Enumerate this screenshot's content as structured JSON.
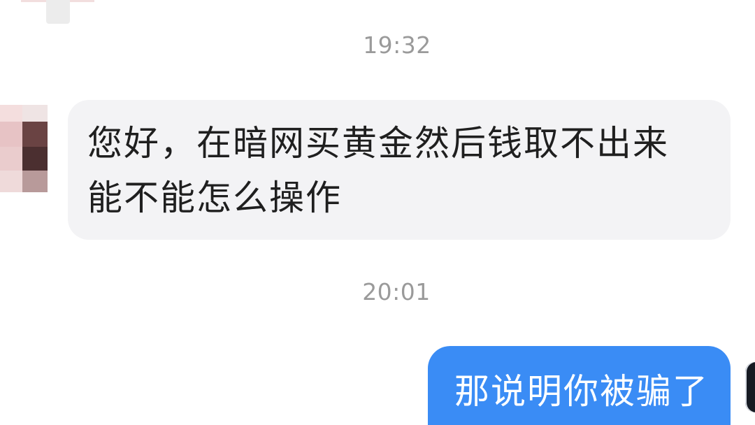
{
  "conversation": {
    "messages": [
      {
        "type": "timestamp",
        "text": "19:32"
      },
      {
        "type": "incoming",
        "lines": [
          "您好，在暗网买黄金然后钱取不出来",
          "能不能怎么操作"
        ]
      },
      {
        "type": "timestamp",
        "text": "20:01"
      },
      {
        "type": "outgoing",
        "lines": [
          "那说明你被骗了"
        ]
      }
    ]
  },
  "colors": {
    "incoming_bubble": "#f3f3f5",
    "outgoing_bubble": "#3a8cf5",
    "timestamp_text": "#9a9a9a",
    "message_text": "#1f1f1f",
    "outgoing_text": "#ffffff"
  },
  "icons": {
    "left_avatar": "pixelated-avatar",
    "right_avatar": "user-avatar"
  }
}
